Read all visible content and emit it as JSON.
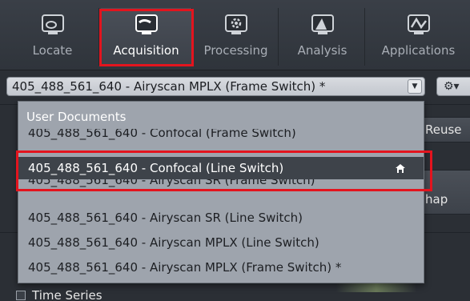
{
  "tabs": [
    {
      "label": "Locate",
      "icon": "locate-icon",
      "active": false
    },
    {
      "label": "Acquisition",
      "icon": "acquisition-icon",
      "active": true
    },
    {
      "label": "Processing",
      "icon": "processing-icon",
      "active": false
    },
    {
      "label": "Analysis",
      "icon": "analysis-icon",
      "active": false
    },
    {
      "label": "Applications",
      "icon": "applications-icon",
      "active": false
    }
  ],
  "experiment_selector": {
    "value": "405_488_561_640 - Airyscan MPLX (Frame Switch) *",
    "arrow": "▼"
  },
  "gear_menu": {
    "icon": "⚙▾"
  },
  "background_panel": {
    "reuse_label": "Reuse",
    "map_label": "hap",
    "time_series_label": "Time Series"
  },
  "dropdown": {
    "header": "User Documents",
    "items": [
      {
        "label": "405_488_561_640 - Confocal (Frame Switch)",
        "selected": false
      },
      {
        "label": "405_488_561_640 - Confocal (Line Switch)",
        "selected": true,
        "icon": "home-icon"
      },
      {
        "label": "405_488_561_640 - Airyscan SR (Frame Switch)",
        "selected": false
      },
      {
        "label": "405_488_561_640 - Airyscan SR (Line Switch)",
        "selected": false
      },
      {
        "label": "405_488_561_640 - Airyscan MPLX (Line Switch)",
        "selected": false
      },
      {
        "label": "405_488_561_640 - Airyscan MPLX (Frame Switch) *",
        "selected": false
      }
    ]
  },
  "colors": {
    "highlight": "#e3141e",
    "dropdown_bg": "#9ea4ad",
    "selected_bg": "#3e434a"
  }
}
